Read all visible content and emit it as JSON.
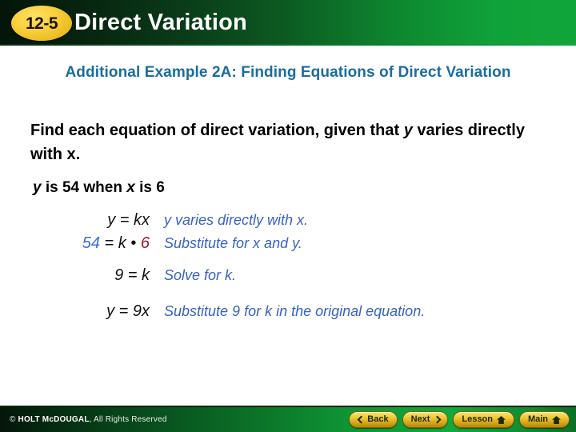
{
  "header": {
    "badge": "12-5",
    "title": "Direct Variation",
    "badge_color": "#f2c927",
    "bar_color_dark": "#04150a",
    "bar_color_light": "#10a53b"
  },
  "subtitle": "Additional Example 2A: Finding Equations of Direct Variation",
  "subtitle_color": "#1a6d9e",
  "prompt": {
    "line1_a": "Find each equation of direct variation, given that ",
    "line1_var1": "y",
    "line1_b": " varies directly with x."
  },
  "given": {
    "var": "y",
    "text_a": " is 54 when ",
    "var2": "x",
    "text_b": " is 6"
  },
  "work": {
    "rows": [
      {
        "equation_plain": "y = kx",
        "eq_parts": [
          {
            "text": "y",
            "color": "#111111"
          },
          {
            "text": " = kx",
            "color": "#111111"
          }
        ],
        "description": "y varies directly with x."
      },
      {
        "equation_plain": "54 = k • 6",
        "eq_parts": [
          {
            "text": "54",
            "color": "#3b6fd4"
          },
          {
            "text": " = k • ",
            "color": "#111111"
          },
          {
            "text": "6",
            "color": "#a4112a"
          }
        ],
        "description": "Substitute for x and y."
      },
      {
        "equation_plain": "9 = k",
        "eq_parts": [
          {
            "text": "9 = k",
            "color": "#111111"
          }
        ],
        "description": "Solve for k."
      },
      {
        "equation_plain": "y = 9x",
        "eq_parts": [
          {
            "text": "y = 9x",
            "color": "#111111"
          }
        ],
        "description": "Substitute 9 for k in the original equation."
      }
    ],
    "description_color": "#3761c4"
  },
  "footer": {
    "copyright_mark": "© ",
    "copyright_brand": "HOLT McDOUGAL",
    "copyright_rest": ", All Rights Reserved",
    "buttons": [
      {
        "label": "Back",
        "icon": "chevron-left-icon"
      },
      {
        "label": "Next",
        "icon": "chevron-right-icon"
      },
      {
        "label": "Lesson",
        "icon": "home-icon"
      },
      {
        "label": "Main",
        "icon": "home-icon"
      }
    ],
    "bar_color": "#0e9434",
    "button_color": "#f0c832"
  }
}
